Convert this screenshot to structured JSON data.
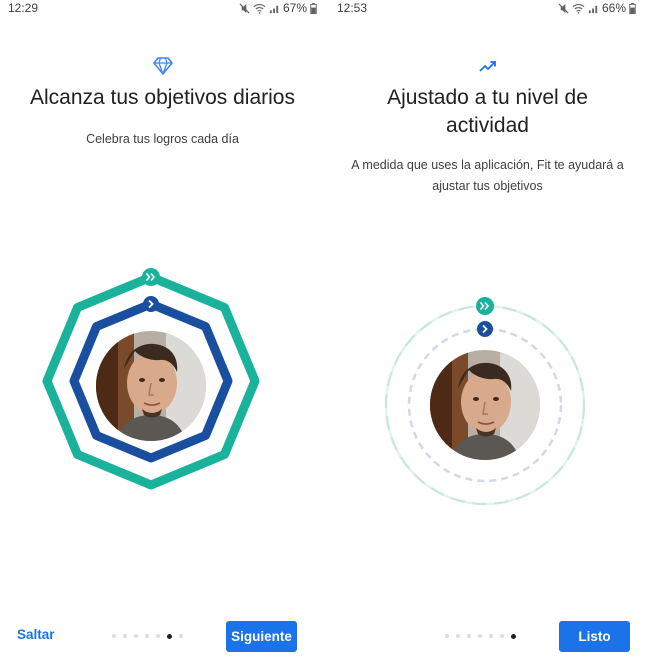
{
  "screens": [
    {
      "status": {
        "time": "12:29",
        "battery": "67%"
      },
      "header_icon": "diamond-icon",
      "title": "Alcanza tus objetivos diarios",
      "subtitle": "Celebra tus logros cada día",
      "skip_label": "Saltar",
      "next_label": "Siguiente",
      "page_count": 7,
      "active_page": 6
    },
    {
      "status": {
        "time": "12:53",
        "battery": "66%"
      },
      "header_icon": "trending-up-icon",
      "title": "Ajustado a tu nivel de actividad",
      "subtitle": "A medida que uses la aplicación, Fit te ayudará a ajustar tus objetivos",
      "done_label": "Listo",
      "page_count": 7,
      "active_page": 7
    }
  ],
  "colors": {
    "accent": "#1a73e8",
    "heart_points": "#1ab29a",
    "move_minutes": "#1a4fa0",
    "icon_blue": "#4285f4",
    "dot_inactive": "#dadce0",
    "dot_active": "#202124"
  }
}
